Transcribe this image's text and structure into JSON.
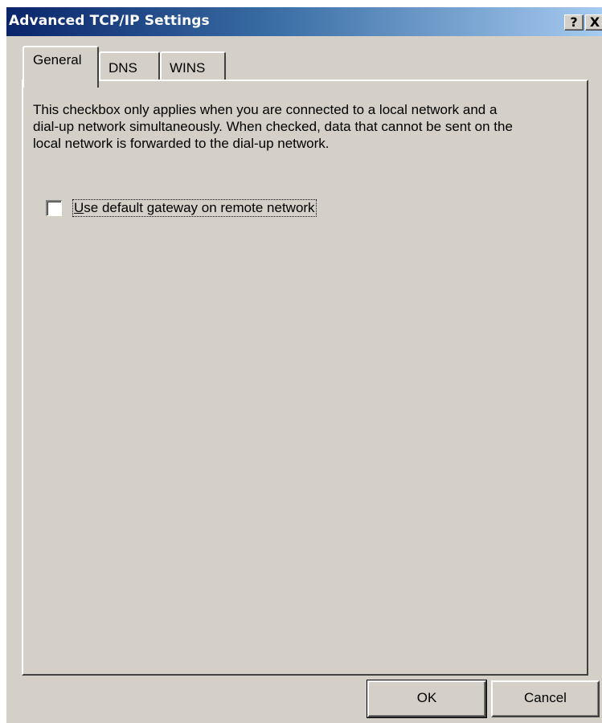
{
  "window": {
    "title": "Advanced TCP/IP Settings",
    "help_label": "?",
    "close_label": "X"
  },
  "tabs": [
    {
      "label": "General",
      "selected": true
    },
    {
      "label": "DNS",
      "selected": false
    },
    {
      "label": "WINS",
      "selected": false
    }
  ],
  "general": {
    "description": "This checkbox only applies when you are connected to a local network and a dial-up network simultaneously.  When checked, data that cannot be sent on the local network is forwarded to the dial-up network.",
    "checkbox": {
      "accel": "U",
      "label_rest": "se default gateway on remote network",
      "checked": false
    }
  },
  "buttons": {
    "ok": "OK",
    "cancel": "Cancel"
  },
  "colors": {
    "title_gradient_start": "#0a246a",
    "title_gradient_end": "#a6caf0",
    "face": "#d4d0c8"
  }
}
